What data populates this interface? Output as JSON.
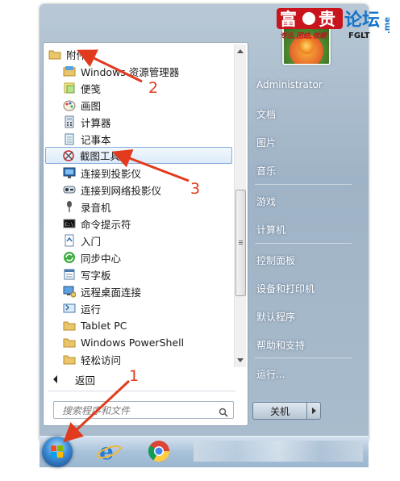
{
  "programs": [
    {
      "label": "附件",
      "icon": "folder-icon"
    },
    {
      "label": "Windows 资源管理器",
      "icon": "explorer-icon"
    },
    {
      "label": "便笺",
      "icon": "sticky-notes-icon"
    },
    {
      "label": "画图",
      "icon": "paint-icon"
    },
    {
      "label": "计算器",
      "icon": "calculator-icon"
    },
    {
      "label": "记事本",
      "icon": "notepad-icon"
    },
    {
      "label": "截图工具",
      "icon": "snipping-tool-icon"
    },
    {
      "label": "连接到投影仪",
      "icon": "projector-icon"
    },
    {
      "label": "连接到网络投影仪",
      "icon": "network-projector-icon"
    },
    {
      "label": "录音机",
      "icon": "microphone-icon"
    },
    {
      "label": "命令提示符",
      "icon": "command-prompt-icon"
    },
    {
      "label": "入门",
      "icon": "getting-started-icon"
    },
    {
      "label": "同步中心",
      "icon": "sync-center-icon"
    },
    {
      "label": "写字板",
      "icon": "wordpad-icon"
    },
    {
      "label": "远程桌面连接",
      "icon": "remote-desktop-icon"
    },
    {
      "label": "运行",
      "icon": "run-icon"
    },
    {
      "label": "Tablet PC",
      "icon": "folder-icon"
    },
    {
      "label": "Windows PowerShell",
      "icon": "folder-icon"
    },
    {
      "label": "轻松访问",
      "icon": "folder-icon"
    }
  ],
  "back_label": "返回",
  "search_placeholder": "搜索程序和文件",
  "right_items": [
    "Administrator",
    "文档",
    "图片",
    "音乐",
    "游戏",
    "计算机",
    "控制面板",
    "设备和打印机",
    "默认程序",
    "帮助和支持",
    "运行..."
  ],
  "shutdown_label": "关机",
  "annotations": [
    "2",
    "3",
    "1"
  ],
  "logo": {
    "title": "富贵论坛",
    "subtitle": "专业,团结,信赖",
    "en": "FGLT",
    "tld": ".me"
  },
  "colors": {
    "annotation": "#e23a1d",
    "selection_border": "#84acdd",
    "taskbar": "#a9c2da"
  }
}
